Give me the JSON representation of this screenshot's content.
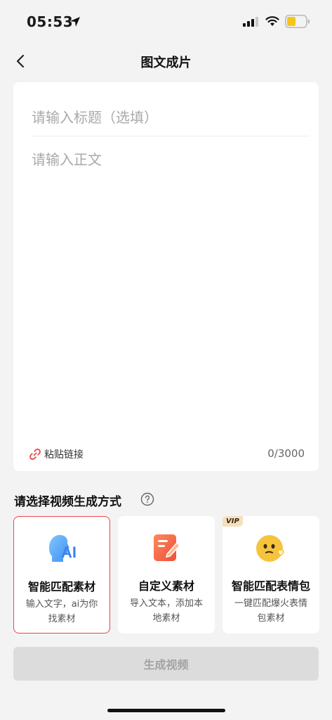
{
  "status_bar": {
    "time": "05:53"
  },
  "nav": {
    "title": "图文成片"
  },
  "editor": {
    "title_placeholder": "请输入标题（选填）",
    "body_placeholder": "请输入正文",
    "paste_link_label": "粘贴链接",
    "char_count": "0/3000"
  },
  "mode_section": {
    "title": "请选择视频生成方式",
    "options": [
      {
        "title": "智能匹配素材",
        "desc": "输入文字，ai为你找素材",
        "icon": "ai-head-icon",
        "selected": true
      },
      {
        "title": "自定义素材",
        "desc": "导入文本，添加本地素材",
        "icon": "edit-document-icon",
        "selected": false
      },
      {
        "title": "智能匹配表情包",
        "desc": "一键匹配爆火表情包素材",
        "icon": "emoji-face-icon",
        "selected": false,
        "badge": "VIP"
      }
    ]
  },
  "generate_button": {
    "label": "生成视频"
  },
  "colors": {
    "accent": "#e8464c",
    "background": "#f3f3f3",
    "button_disabled": "#dcdcdc",
    "vip_badge": "#f5dfbf"
  }
}
